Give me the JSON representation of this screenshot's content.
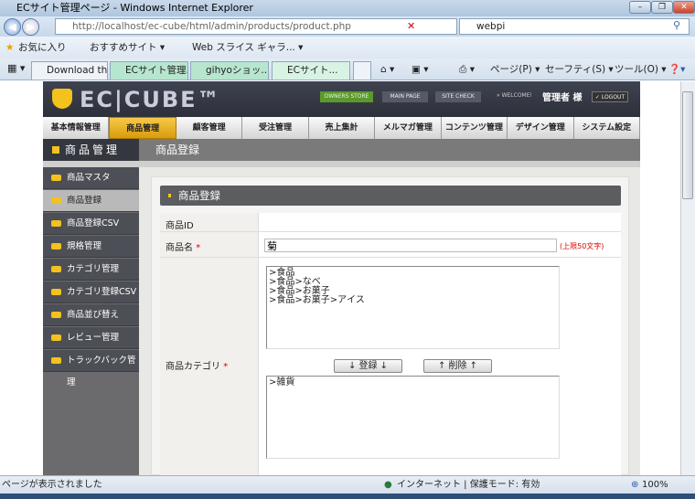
{
  "browser": {
    "title": "ECサイト管理ページ - Windows Internet Explorer",
    "url": "http://localhost/ec-cube/html/admin/products/product.php",
    "search_value": "webpi",
    "favorites": [
      "お気に入り",
      "おすすめサイト ▾",
      "Web スライス ギャラ... ▾"
    ],
    "tabs": [
      {
        "label": "Download th..."
      },
      {
        "label": "ECサイト管理..."
      },
      {
        "label": "gihyoショッ..."
      },
      {
        "label": "ECサイト..."
      }
    ],
    "commands": [
      "ページ(P) ▾",
      "セーフティ(S) ▾",
      "ツール(O) ▾"
    ],
    "status_left": "ページが表示されました",
    "status_zone": "インターネット | 保護モード: 有効",
    "zoom": "100%"
  },
  "header": {
    "logo": "EC|CUBE™",
    "owners_store": "OWNERS STORE",
    "main_page": "MAIN PAGE",
    "site_check": "SITE CHECK",
    "welcome": "» WELCOME!",
    "user": "管理者 様",
    "logout": "✓ LOGOUT"
  },
  "nav": [
    "基本情報管理",
    "商品管理",
    "顧客管理",
    "受注管理",
    "売上集計",
    "メルマガ管理",
    "コンテンツ管理",
    "デザイン管理",
    "システム設定"
  ],
  "subheader": {
    "section": "商品管理",
    "page": "商品登録"
  },
  "sidebar": [
    "商品マスタ",
    "商品登録",
    "商品登録CSV",
    "規格管理",
    "カテゴリ管理",
    "カテゴリ登録CSV",
    "商品並び替え",
    "レビュー管理",
    "トラックバック管理"
  ],
  "form": {
    "heading": "商品登録",
    "id_label": "商品ID",
    "name_label": "商品名",
    "required": "*",
    "name_value": "菊",
    "name_note": "(上限50文字)",
    "category_label": "商品カテゴリ",
    "available_categories": [
      ">食品",
      ">食品>なべ",
      ">食品>お菓子",
      ">食品>お菓子>アイス"
    ],
    "register_button": "↓ 登録 ↓",
    "delete_button": "↑ 削除 ↑",
    "selected_categories": [
      ">雑貨"
    ]
  },
  "colors": {
    "accent": "#f4c21c",
    "header": "#34373f",
    "required": "#dd0000"
  }
}
